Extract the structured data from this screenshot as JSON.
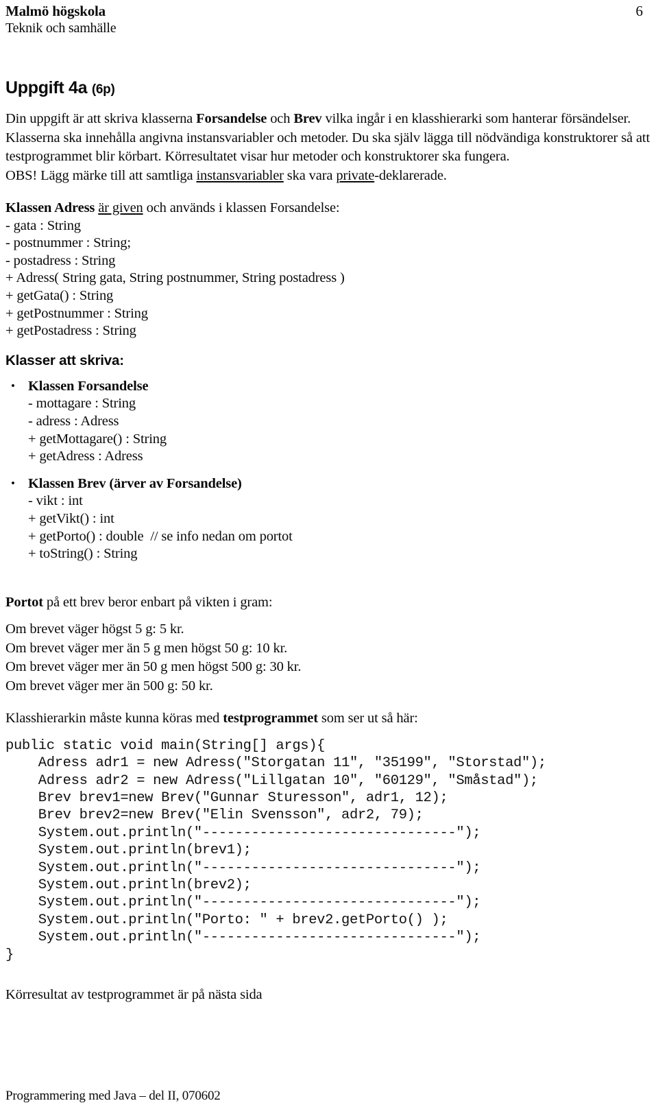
{
  "header": {
    "organization": "Malmö högskola",
    "department": "Teknik och samhälle",
    "page_number": "6"
  },
  "task": {
    "title": "Uppgift 4a",
    "points": "(6p)",
    "intro_line1_a": "Din uppgift är att skriva klasserna ",
    "intro_bold1": "Forsandelse",
    "intro_line1_b": " och ",
    "intro_bold2": "Brev",
    "intro_line1_c": " vilka ingår i en klasshierarki som hanterar försändelser. Klasserna ska innehålla angivna instansvariabler och metoder. Du ska själv lägga till nödvändiga konstruktorer så att testprogrammet blir körbart. Körresultatet visar hur metoder och konstruktorer ska fungera.",
    "obs_a": "OBS! Lägg märke till att samtliga ",
    "obs_u1": "instansvariabler",
    "obs_b": " ska vara ",
    "obs_u2": "private",
    "obs_c": "-deklarerade."
  },
  "adress_class": {
    "heading_bold": "Klassen Adress ",
    "heading_underline": "är given",
    "heading_rest": " och används i klassen Forsandelse:",
    "members": [
      "- gata : String",
      "- postnummer : String;",
      "- postadress : String",
      "+ Adress( String gata, String postnummer, String postadress )",
      "+ getGata() : String",
      "+ getPostnummer : String",
      "+ getPostadress : String"
    ]
  },
  "classes_to_write": {
    "heading": "Klasser att skriva:",
    "items": [
      {
        "bullet_glyph": "•",
        "name": "Klassen Forsandelse",
        "members": [
          "- mottagare : String",
          "- adress : Adress",
          "+ getMottagare() : String",
          "+ getAdress : Adress"
        ]
      },
      {
        "bullet_glyph": "•",
        "name": "Klassen Brev (ärver av Forsandelse)",
        "members": [
          "- vikt : int",
          "+ getVikt() : int",
          "+ getPorto() : double  // se info nedan om portot",
          "+ toString() : String"
        ]
      }
    ]
  },
  "porto": {
    "lead_bold": "Portot",
    "lead_rest": " på ett brev beror enbart på vikten i gram:",
    "rules": [
      "Om brevet väger högst 5 g: 5 kr.",
      "Om brevet väger mer än 5 g men högst 50 g: 10 kr.",
      "Om brevet väger mer än 50 g men högst 500 g: 30 kr.",
      "Om brevet väger mer än 500 g: 50 kr."
    ]
  },
  "test_program": {
    "intro_a": "Klasshierarkin måste kunna köras med ",
    "intro_bold": "testprogrammet",
    "intro_b": " som ser ut så här:",
    "code": "public static void main(String[] args){\n    Adress adr1 = new Adress(\"Storgatan 11\", \"35199\", \"Storstad\");\n    Adress adr2 = new Adress(\"Lillgatan 10\", \"60129\", \"Småstad\");\n    Brev brev1=new Brev(\"Gunnar Sturesson\", adr1, 12);\n    Brev brev2=new Brev(\"Elin Svensson\", adr2, 79);\n    System.out.println(\"-------------------------------\");\n    System.out.println(brev1);\n    System.out.println(\"-------------------------------\");\n    System.out.println(brev2);\n    System.out.println(\"-------------------------------\");\n    System.out.println(\"Porto: \" + brev2.getPorto() );\n    System.out.println(\"-------------------------------\");\n}"
  },
  "closing_note": "Körresultat av testprogrammet är på nästa sida",
  "footer": {
    "text": "Programmering med Java – del II, 070602"
  }
}
